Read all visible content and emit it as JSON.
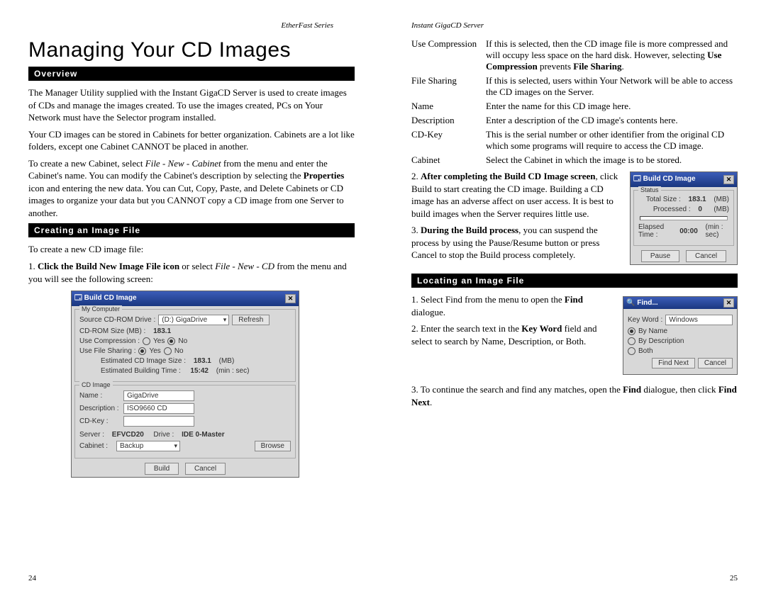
{
  "left": {
    "running": "EtherFast Series",
    "title": "Managing Your CD Images",
    "sec_overview": "Overview",
    "p1": "The Manager Utility supplied with the Instant GigaCD Server is used to create images of CDs and manage the images created. To use the images created, PCs on Your Network must have the Selector program installed.",
    "p2": "Your CD images can be stored in Cabinets for better organization. Cabinets are a lot like folders, except one Cabinet CANNOT be placed in another.",
    "p3a": "To create a new Cabinet, select ",
    "p3i": "File - New - Cabinet",
    "p3b": " from the menu and enter the Cabinet's name. You can modify the Cabinet's description by selecting the ",
    "p3c": "Properties",
    "p3d": " icon and entering the new data. You can Cut, Copy, Paste, and Delete Cabinets or CD images to organize your data but you CANNOT copy a CD image from one Server to another.",
    "sec_create": "Creating an Image File",
    "p4": "To create a new CD image file:",
    "p5a": "1. ",
    "p5b": "Click the Build New Image File icon",
    "p5c": " or select ",
    "p5i": "File - New - CD",
    "p5d": " from the menu and you will see the following screen:",
    "pagenum": "24",
    "dlg": {
      "title": "Build CD Image",
      "grp1": "My Computer",
      "src_lbl": "Source CD-ROM Drive :",
      "src_val": "(D:) GigaDrive",
      "refresh": "Refresh",
      "size_lbl": "CD-ROM Size (MB) :",
      "size_val": "183.1",
      "compress": "Use Compression :",
      "yes": "Yes",
      "no": "No",
      "fileshare": "Use File Sharing :",
      "est_size": "Estimated CD Image Size :",
      "est_size_val": "183.1",
      "mb": "(MB)",
      "est_time": "Estimated Building Time :",
      "est_time_val": "15:42",
      "minsec": "(min : sec)",
      "grp2": "CD Image",
      "name_lbl": "Name :",
      "name_val": "GigaDrive",
      "desc_lbl": "Description :",
      "desc_val": "ISO9660 CD",
      "cdkey_lbl": "CD-Key :",
      "server_lbl": "Server :",
      "server_val": "EFVCD20",
      "drive_lbl": "Drive :",
      "drive_val": "IDE 0-Master",
      "cabinet_lbl": "Cabinet :",
      "cabinet_val": "Backup",
      "browse": "Browse",
      "build": "Build",
      "cancel": "Cancel"
    }
  },
  "right": {
    "running": "Instant GigaCD Server",
    "defs": [
      {
        "term": "Use Compression",
        "desc_a": "If this is selected, then the CD image file is more compressed and will occupy less space on the hard disk. However, selecting ",
        "desc_b": "Use Compression",
        "desc_c": " prevents ",
        "desc_d": "File Sharing",
        "desc_e": "."
      },
      {
        "term": "File Sharing",
        "desc_a": "If this is selected, users within Your Network will be able to access the CD images on the Server."
      },
      {
        "term": "Name",
        "desc_a": "Enter the name for this CD image here."
      },
      {
        "term": "Description",
        "desc_a": "Enter a description of the CD image's contents here."
      },
      {
        "term": "CD-Key",
        "desc_a": "This is the serial number or other identifier from the original CD which some programs will require to access the CD image."
      },
      {
        "term": "Cabinet",
        "desc_a": "Select the Cabinet in which the image is to be stored."
      }
    ],
    "p2a": "2. ",
    "p2b": "After completing the Build CD Image screen",
    "p2c": ", click Build to start creating the CD image. Building a CD image has an adverse affect on user access. It is best to build images when the Server requires little use.",
    "p3a": "3. ",
    "p3b": "During the Build process",
    "p3c": ", you can suspend the process by using the Pause/Resume button or press Cancel to stop the Build process completely.",
    "sec_locate": "Locating an Image File",
    "loc1a": "1. Select Find from the menu to open the ",
    "loc1b": "Find",
    "loc1c": " dialogue.",
    "loc2a": "2. Enter the search text in the ",
    "loc2b": "Key Word",
    "loc2c": " field and select to search by Name, Description, or Both.",
    "loc3a": "3. To continue the search and find any matches, open the ",
    "loc3b": "Find",
    "loc3c": " dialogue, then click ",
    "loc3d": "Find Next",
    "loc3e": ".",
    "pagenum": "25",
    "status_dlg": {
      "title": "Build CD Image",
      "grp": "Status",
      "total": "Total Size :",
      "total_val": "183.1",
      "mb": "(MB)",
      "proc": "Processed :",
      "proc_val": "0",
      "elapsed": "Elapsed Time :",
      "elapsed_val": "00:00",
      "minsec": "(min : sec)",
      "pause": "Pause",
      "cancel": "Cancel"
    },
    "find_dlg": {
      "title": "Find...",
      "kw": "Key Word :",
      "kw_val": "Windows",
      "byname": "By Name",
      "bydesc": "By Description",
      "both": "Both",
      "findnext": "Find Next",
      "cancel": "Cancel"
    }
  }
}
